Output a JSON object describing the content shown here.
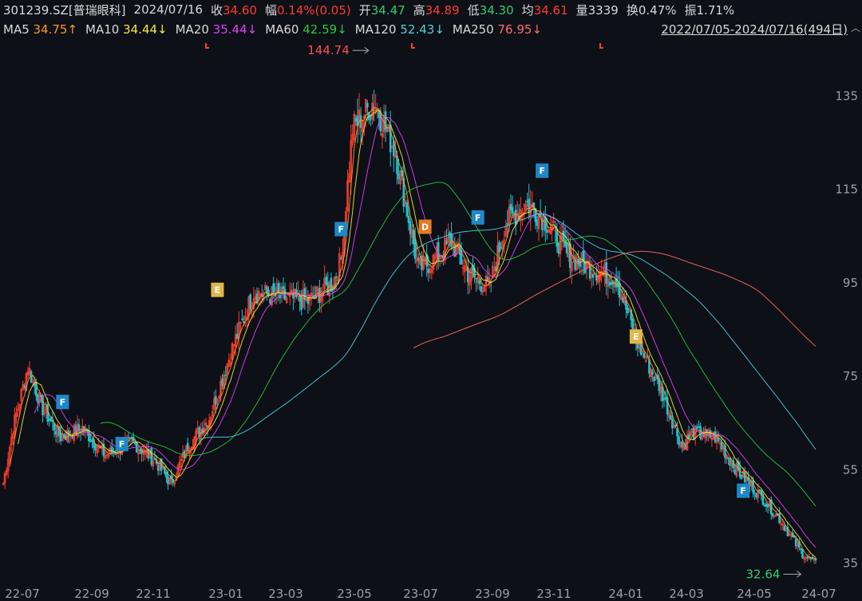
{
  "header": {
    "symbol": "301239.SZ[普瑞眼科]",
    "date": "2024/07/16",
    "close_label": "收",
    "close": "34.60",
    "change_label": "幅",
    "change": "0.14%(0.05)",
    "open_label": "开",
    "open": "34.47",
    "high_label": "高",
    "high": "34.89",
    "low_label": "低",
    "low": "34.30",
    "avg_label": "均",
    "avg": "34.61",
    "vol_label": "量",
    "vol": "3339",
    "turnover_label": "换",
    "turnover": "0.47%",
    "amp_label": "振",
    "amp": "1.71%"
  },
  "ma_legend": [
    {
      "label": "MA5",
      "value": "34.75↑",
      "color": "#ff9a1f"
    },
    {
      "label": "MA10",
      "value": "34.44↓",
      "color": "#f5e642"
    },
    {
      "label": "MA20",
      "value": "35.44↓",
      "color": "#e040fb"
    },
    {
      "label": "MA60",
      "value": "42.59↓",
      "color": "#27c93f"
    },
    {
      "label": "MA120",
      "value": "52.43↓",
      "color": "#4dd0e1"
    },
    {
      "label": "MA250",
      "value": "76.95↓",
      "color": "#ff6b6b"
    }
  ],
  "range_text": "2022/07/05-2024/07/16(494日)",
  "chart_data": {
    "type": "candlestick",
    "ylim": [
      31,
      147
    ],
    "y_ticks": [
      "135",
      "115",
      "95",
      "75",
      "55",
      "35"
    ],
    "x_ticks": [
      "22-07",
      "22-09",
      "22-11",
      "23-01",
      "23-03",
      "23-05",
      "23-07",
      "23-09",
      "23-11",
      "24-01",
      "24-03",
      "24-05",
      "24-07"
    ],
    "max_label": "144.74",
    "min_label": "32.64",
    "price_anchors": [
      [
        0,
        52
      ],
      [
        6,
        64
      ],
      [
        15,
        77
      ],
      [
        24,
        68
      ],
      [
        35,
        62
      ],
      [
        48,
        64
      ],
      [
        62,
        58
      ],
      [
        78,
        61
      ],
      [
        92,
        57
      ],
      [
        102,
        52
      ],
      [
        112,
        60
      ],
      [
        125,
        66
      ],
      [
        140,
        82
      ],
      [
        152,
        93
      ],
      [
        168,
        92
      ],
      [
        185,
        91
      ],
      [
        200,
        95
      ],
      [
        205,
        100
      ],
      [
        212,
        128
      ],
      [
        225,
        134
      ],
      [
        238,
        123
      ],
      [
        252,
        98
      ],
      [
        262,
        100
      ],
      [
        272,
        104
      ],
      [
        282,
        97
      ],
      [
        295,
        94
      ],
      [
        305,
        108
      ],
      [
        318,
        112
      ],
      [
        330,
        108
      ],
      [
        342,
        101
      ],
      [
        358,
        98
      ],
      [
        372,
        96
      ],
      [
        385,
        82
      ],
      [
        398,
        73
      ],
      [
        412,
        60
      ],
      [
        418,
        63
      ],
      [
        432,
        62
      ],
      [
        445,
        55
      ],
      [
        458,
        50
      ],
      [
        470,
        45
      ],
      [
        485,
        37
      ],
      [
        493,
        35
      ]
    ],
    "moving_averages": [
      {
        "name": "MA5",
        "color": "#ff9a1f",
        "window": 5,
        "start": 4
      },
      {
        "name": "MA10",
        "color": "#f5e642",
        "window": 10,
        "start": 9
      },
      {
        "name": "MA20",
        "color": "#e040fb",
        "window": 20,
        "start": 19
      },
      {
        "name": "MA60",
        "color": "#27c93f",
        "window": 60,
        "start": 59
      },
      {
        "name": "MA120",
        "color": "#4dd0e1",
        "window": 120,
        "start": 119
      },
      {
        "name": "MA250",
        "color": "#ff6b6b",
        "window": 250,
        "start": 249
      }
    ],
    "events": [
      {
        "label": "F",
        "color": "#1e88c7",
        "index": 36,
        "price": 69.5
      },
      {
        "label": "F",
        "color": "#1e88c7",
        "index": 72,
        "price": 60.5
      },
      {
        "label": "E",
        "color": "#e0b74a",
        "index": 130,
        "price": 93.5
      },
      {
        "label": "F",
        "color": "#1e88c7",
        "index": 205,
        "price": 106.5
      },
      {
        "label": "D",
        "color": "#e57b22",
        "index": 256,
        "price": 107
      },
      {
        "label": "F",
        "color": "#1e88c7",
        "index": 288,
        "price": 109
      },
      {
        "label": "F",
        "color": "#1e88c7",
        "index": 327,
        "price": 119
      },
      {
        "label": "E",
        "color": "#e0b74a",
        "index": 384,
        "price": 83.5
      },
      {
        "label": "F",
        "color": "#1e88c7",
        "index": 449,
        "price": 50.5
      }
    ]
  }
}
